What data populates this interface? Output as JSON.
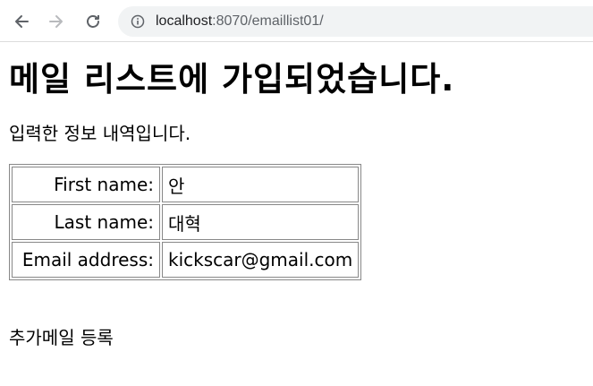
{
  "browser": {
    "url_host": "localhost",
    "url_rest": ":8070/emaillist01/"
  },
  "page": {
    "heading": "메일 리스트에 가입되었습니다.",
    "intro": "입력한 정보 내역입니다.",
    "rows": [
      {
        "label": "First name:",
        "value": "안"
      },
      {
        "label": "Last name:",
        "value": "대혁"
      },
      {
        "label": "Email address:",
        "value": "kickscar@gmail.com"
      }
    ],
    "add_link": "추가메일 등록"
  }
}
